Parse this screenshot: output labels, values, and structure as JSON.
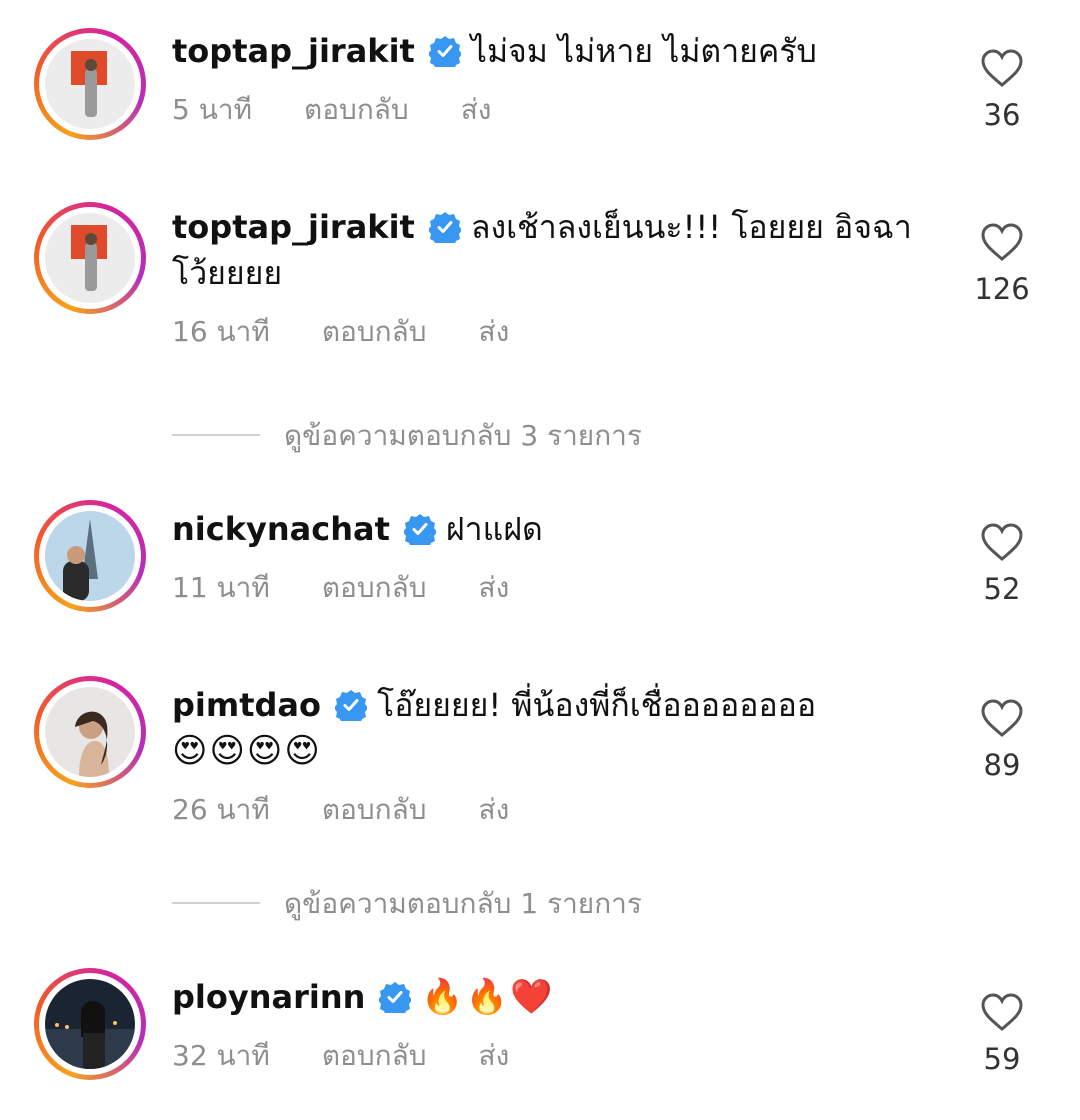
{
  "comments": [
    {
      "username": "toptap_jirakit",
      "text": "ไม่จม ไม่หาย ไม่ตายครับ",
      "time": "5 นาที",
      "reply_label": "ตอบกลับ",
      "send_label": "ส่ง",
      "likes": "36",
      "avatar": "red-art-gallery-avatar"
    },
    {
      "username": "toptap_jirakit",
      "text": "ลงเช้าลงเย็นนะ!!! โอยยย อิจฉา โว้ยยยย",
      "time": "16 นาที",
      "reply_label": "ตอบกลับ",
      "send_label": "ส่ง",
      "likes": "126",
      "avatar": "red-art-gallery-avatar"
    },
    {
      "username": "nickynachat",
      "text": "ฝาแฝด",
      "time": "11 นาที",
      "reply_label": "ตอบกลับ",
      "send_label": "ส่ง",
      "likes": "52",
      "avatar": "eiffel-tower-avatar"
    },
    {
      "username": "pimtdao",
      "text": "โอ๊ยยยย! พี่น้องพี่ก็เชื่ออออออออ",
      "emoji": "😍😍😍😍",
      "time": "26 นาที",
      "reply_label": "ตอบกลับ",
      "send_label": "ส่ง",
      "likes": "89",
      "avatar": "portrait-avatar"
    },
    {
      "username": "ploynarinn",
      "text": "",
      "emoji": "🔥🔥❤️",
      "time": "32 นาที",
      "reply_label": "ตอบกลับ",
      "send_label": "ส่ง",
      "likes": "59",
      "avatar": "night-city-avatar"
    }
  ],
  "view_replies": [
    {
      "label": "ดูข้อความตอบกลับ 3 รายการ"
    },
    {
      "label": "ดูข้อความตอบกลับ 1 รายการ"
    }
  ],
  "colors": {
    "verified": "#3897f0",
    "meta": "#8e8e8e",
    "ring_start": "#f7a21b",
    "ring_end": "#d6249f"
  }
}
